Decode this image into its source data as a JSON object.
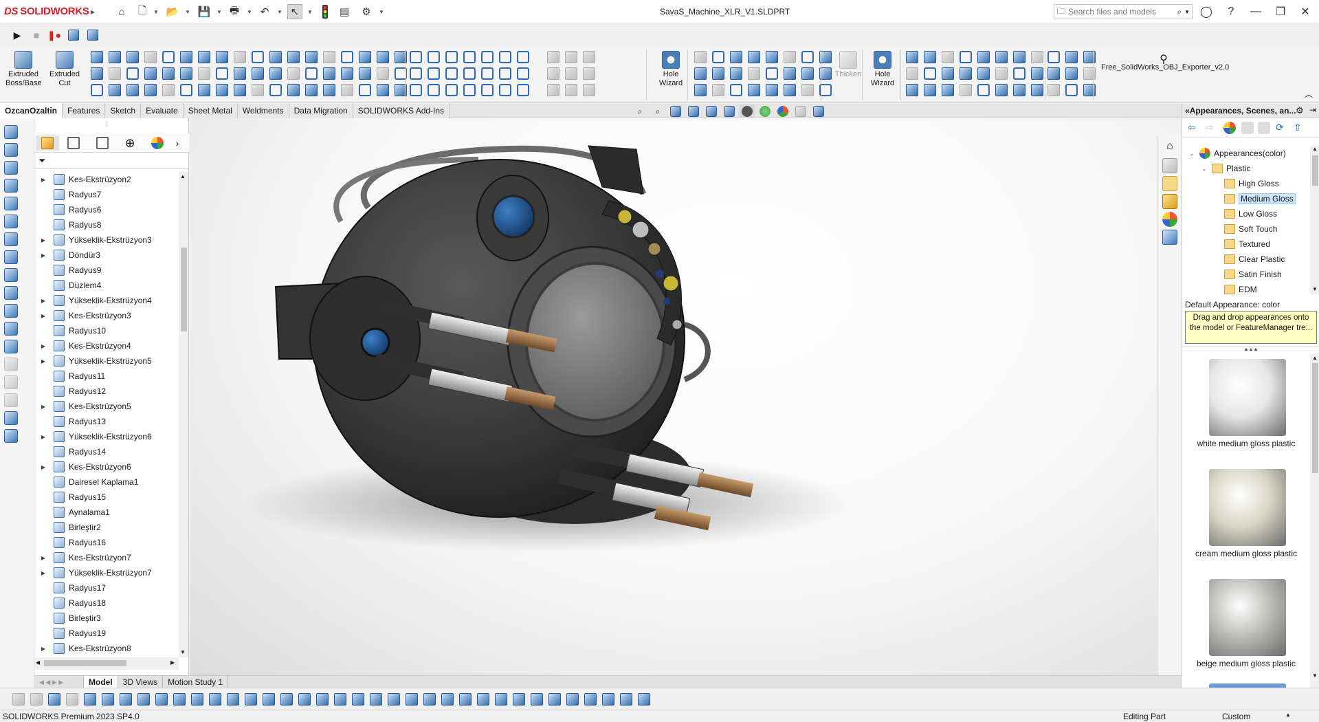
{
  "app": {
    "brand_ds": "DS",
    "brand_name": "SOLIDWORKS",
    "document_title": "SavaS_Machine_XLR_V1.SLDPRT",
    "search_placeholder": "Search files and models",
    "accent": "#d4202b"
  },
  "command_manager": {
    "extruded_boss": "Extruded Boss/Base",
    "extruded_cut": "Extruded Cut",
    "hole_wizard_1": "Hole Wizard",
    "thicken": "Thicken",
    "hole_wizard_2": "Hole Wizard",
    "exporter": "Free_SolidWorks_OBJ_Exporter_v2.0",
    "tabs": [
      "OzcanOzaltin",
      "Features",
      "Sketch",
      "Evaluate",
      "Sheet Metal",
      "Weldments",
      "Data Migration",
      "SOLIDWORKS Add-Ins"
    ]
  },
  "feature_tree": {
    "items": [
      {
        "label": "Kes-Ekstrüzyon2",
        "expandable": true
      },
      {
        "label": "Radyus7",
        "expandable": false
      },
      {
        "label": "Radyus6",
        "expandable": false
      },
      {
        "label": "Radyus8",
        "expandable": false
      },
      {
        "label": "Yükseklik-Ekstrüzyon3",
        "expandable": true
      },
      {
        "label": "Döndür3",
        "expandable": true
      },
      {
        "label": "Radyus9",
        "expandable": false
      },
      {
        "label": "Düzlem4",
        "expandable": false
      },
      {
        "label": "Yükseklik-Ekstrüzyon4",
        "expandable": true
      },
      {
        "label": "Kes-Ekstrüzyon3",
        "expandable": true
      },
      {
        "label": "Radyus10",
        "expandable": false
      },
      {
        "label": "Kes-Ekstrüzyon4",
        "expandable": true
      },
      {
        "label": "Yükseklik-Ekstrüzyon5",
        "expandable": true
      },
      {
        "label": "Radyus11",
        "expandable": false
      },
      {
        "label": "Radyus12",
        "expandable": false
      },
      {
        "label": "Kes-Ekstrüzyon5",
        "expandable": true
      },
      {
        "label": "Radyus13",
        "expandable": false
      },
      {
        "label": "Yükseklik-Ekstrüzyon6",
        "expandable": true
      },
      {
        "label": "Radyus14",
        "expandable": false
      },
      {
        "label": "Kes-Ekstrüzyon6",
        "expandable": true
      },
      {
        "label": "Dairesel Kaplama1",
        "expandable": false
      },
      {
        "label": "Radyus15",
        "expandable": false
      },
      {
        "label": "Aynalama1",
        "expandable": false
      },
      {
        "label": "Birleştir2",
        "expandable": false
      },
      {
        "label": "Radyus16",
        "expandable": false
      },
      {
        "label": "Kes-Ekstrüzyon7",
        "expandable": true
      },
      {
        "label": "Yükseklik-Ekstrüzyon7",
        "expandable": true
      },
      {
        "label": "Radyus17",
        "expandable": false
      },
      {
        "label": "Radyus18",
        "expandable": false
      },
      {
        "label": "Birleştir3",
        "expandable": false
      },
      {
        "label": "Radyus19",
        "expandable": false
      },
      {
        "label": "Kes-Ekstrüzyon8",
        "expandable": true
      }
    ]
  },
  "model_tabs": [
    "Model",
    "3D Views",
    "Motion Study 1"
  ],
  "task_pane": {
    "title": "Appearances, Scenes, an...",
    "tree": [
      {
        "label": "Appearances(color)",
        "level": 0,
        "type": "root",
        "expanded": true
      },
      {
        "label": "Plastic",
        "level": 1,
        "type": "folder",
        "expanded": true
      },
      {
        "label": "High Gloss",
        "level": 2,
        "type": "folder"
      },
      {
        "label": "Medium Gloss",
        "level": 2,
        "type": "folder",
        "selected": true
      },
      {
        "label": "Low Gloss",
        "level": 2,
        "type": "folder"
      },
      {
        "label": "Soft Touch",
        "level": 2,
        "type": "folder"
      },
      {
        "label": "Textured",
        "level": 2,
        "type": "folder"
      },
      {
        "label": "Clear Plastic",
        "level": 2,
        "type": "folder"
      },
      {
        "label": "Satin Finish",
        "level": 2,
        "type": "folder"
      },
      {
        "label": "EDM",
        "level": 2,
        "type": "folder"
      }
    ],
    "default_appearance": "Default Appearance: color",
    "tooltip": "Drag and drop appearances onto the model or FeatureManager tre...",
    "swatches": [
      {
        "label": "white medium gloss plastic",
        "color": "#e6e6e6"
      },
      {
        "label": "cream medium gloss plastic",
        "color": "#d9d6c4"
      },
      {
        "label": "beige medium gloss plastic",
        "color": "#bcbcb8"
      }
    ]
  },
  "status": {
    "product": "SOLIDWORKS Premium 2023 SP4.0",
    "mode": "Editing Part",
    "units": "Custom"
  }
}
